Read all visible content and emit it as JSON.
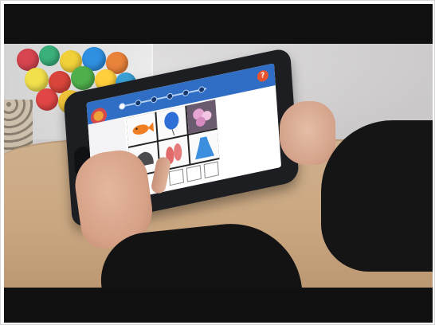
{
  "scene": {
    "description_tags": [
      "child",
      "tablet",
      "educational-app",
      "table"
    ],
    "app": {
      "help_button_label": "?",
      "progress": {
        "total_steps": 6,
        "current_step": 1
      },
      "grid_items": [
        "fish",
        "balloon",
        "photo",
        "rock",
        "slippers",
        "dress"
      ],
      "answer_slots": 3
    }
  },
  "colors": {
    "app_header": "#2f6ec4",
    "help_button": "#e8542f",
    "tablet_case": "#1d1e22",
    "table_wood": "#c9a680",
    "sleeve": "#151515"
  }
}
